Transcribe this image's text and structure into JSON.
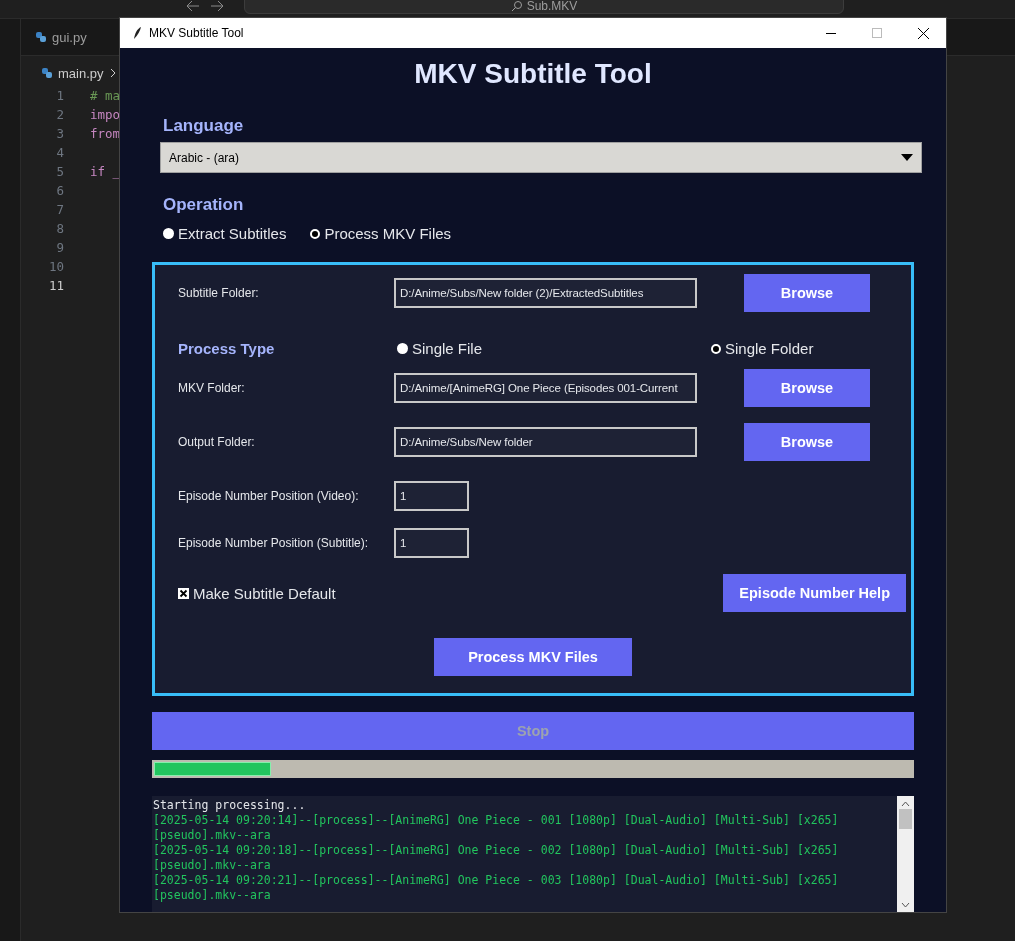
{
  "editor": {
    "search": "Sub.MKV",
    "tab": "gui.py",
    "breadcrumb": "main.py",
    "line_numbers": [
      {
        "text": "1",
        "selected": false
      },
      {
        "text": "2",
        "selected": false
      },
      {
        "text": "3",
        "selected": false
      },
      {
        "text": "4",
        "selected": false
      },
      {
        "text": "5",
        "selected": false
      },
      {
        "text": "6",
        "selected": false
      },
      {
        "text": "7",
        "selected": false
      },
      {
        "text": "8",
        "selected": false
      },
      {
        "text": "9",
        "selected": false
      },
      {
        "text": "10",
        "selected": false
      },
      {
        "text": "11",
        "selected": true
      }
    ],
    "code_lines": [
      {
        "text": "# ma",
        "kind": "comment"
      },
      {
        "text": "impo",
        "kind": "keyword"
      },
      {
        "text": "from",
        "kind": "keyword"
      },
      {
        "kind": "blank"
      },
      {
        "text": "if _",
        "kind": "keyword"
      }
    ]
  },
  "window": {
    "title": "MKV Subtitle Tool"
  },
  "heading": "MKV Subtitle Tool",
  "language": {
    "label": "Language",
    "value": "Arabic - (ara)"
  },
  "operation": {
    "label": "Operation",
    "options": [
      {
        "label": "Extract Subtitles",
        "selected": false
      },
      {
        "label": "Process MKV Files",
        "selected": true
      }
    ]
  },
  "panel": {
    "subtitle_folder": {
      "label": "Subtitle Folder:",
      "value": "D:/Anime/Subs/New folder (2)/ExtractedSubtitles",
      "button": "Browse"
    },
    "process_type": {
      "label": "Process Type",
      "options": [
        {
          "label": "Single File",
          "selected": false
        },
        {
          "label": "Single Folder",
          "selected": true
        }
      ]
    },
    "mkv_folder": {
      "label": "MKV Folder:",
      "value": "D:/Anime/[AnimeRG] One Piece (Episodes 001-Current",
      "button": "Browse"
    },
    "output_folder": {
      "label": "Output Folder:",
      "value": "D:/Anime/Subs/New folder",
      "button": "Browse"
    },
    "episode_video": {
      "label": "Episode Number Position (Video):",
      "value": "1"
    },
    "episode_subtitle": {
      "label": "Episode Number Position (Subtitle):",
      "value": "1"
    },
    "make_default": {
      "label": "Make Subtitle Default",
      "checked": true
    },
    "help_button": "Episode Number Help",
    "process_button": "Process MKV Files"
  },
  "stop_button": {
    "label": "Stop",
    "disabled": true
  },
  "progress": {
    "level": 0.155
  },
  "log": [
    {
      "text": "Starting processing...",
      "kind": "info"
    },
    {
      "text": "[2025-05-14 09:20:14]--[process]--[AnimeRG] One Piece - 001 [1080p] [Dual-Audio] [Multi-Sub] [x265]",
      "kind": "success"
    },
    {
      "text": "[pseudo].mkv--ara",
      "kind": "success"
    },
    {
      "text": "[2025-05-14 09:20:18]--[process]--[AnimeRG] One Piece - 002 [1080p] [Dual-Audio] [Multi-Sub] [x265]",
      "kind": "success"
    },
    {
      "text": "[pseudo].mkv--ara",
      "kind": "success"
    },
    {
      "text": "[2025-05-14 09:20:21]--[process]--[AnimeRG] One Piece - 003 [1080p] [Dual-Audio] [Multi-Sub] [x265]",
      "kind": "success"
    },
    {
      "text": "[pseudo].mkv--ara",
      "kind": "success"
    }
  ]
}
